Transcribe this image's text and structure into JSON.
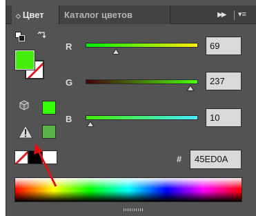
{
  "tabs": [
    {
      "label": "Цвет",
      "active": true
    },
    {
      "label": "Каталог цветов",
      "active": false
    }
  ],
  "fill_color": "#45ED0A",
  "websafe_color": "#33FF00",
  "gamut_color": "#5CB34A",
  "channels": [
    {
      "name": "R",
      "value": "69",
      "fraction": 0.27
    },
    {
      "name": "G",
      "value": "237",
      "fraction": 0.93
    },
    {
      "name": "B",
      "value": "10",
      "fraction": 0.04
    }
  ],
  "hex": {
    "label": "#",
    "value": "45ED0A"
  },
  "icons": [
    "default-colors-icon",
    "swap-icon",
    "websafe-cube-icon",
    "out-of-gamut-warning-icon",
    "collapse-arrows-icon",
    "panel-menu-icon"
  ],
  "annotation_color": "#E01010"
}
